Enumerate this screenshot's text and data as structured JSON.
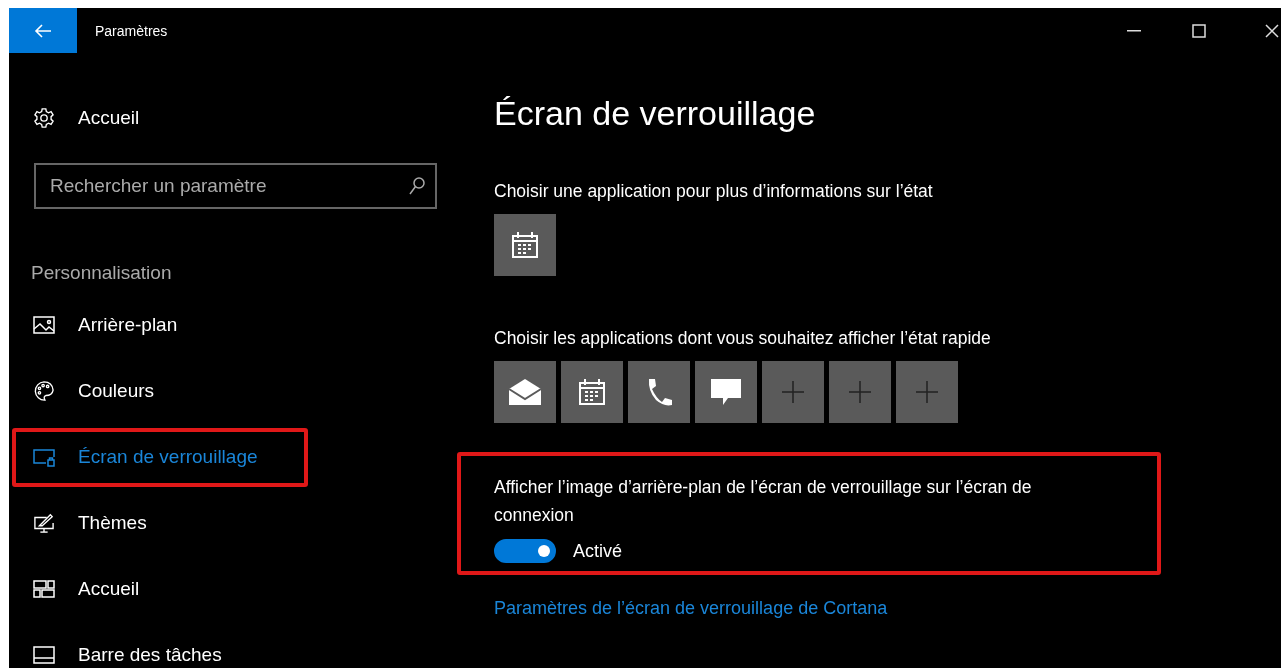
{
  "window": {
    "title": "Paramètres"
  },
  "sidebar": {
    "home": {
      "label": "Accueil"
    },
    "search": {
      "placeholder": "Rechercher un paramètre"
    },
    "section": "Personnalisation",
    "items": [
      {
        "label": "Arrière-plan",
        "kind": "picture",
        "selected": false,
        "highlighted": false
      },
      {
        "label": "Couleurs",
        "kind": "palette",
        "selected": false,
        "highlighted": false
      },
      {
        "label": "Écran de verrouillage",
        "kind": "lock-screen",
        "selected": true,
        "highlighted": true
      },
      {
        "label": "Thèmes",
        "kind": "themes",
        "selected": false,
        "highlighted": false
      },
      {
        "label": "Accueil",
        "kind": "start",
        "selected": false,
        "highlighted": false
      },
      {
        "label": "Barre des tâches",
        "kind": "taskbar",
        "selected": false,
        "highlighted": false
      }
    ]
  },
  "content": {
    "title": "Écran de verrouillage",
    "detailed_status": {
      "label": "Choisir une application pour plus d’informations sur l’état",
      "apps": [
        {
          "kind": "calendar"
        }
      ]
    },
    "quick_status": {
      "label": "Choisir les applications dont vous souhaitez afficher l’état rapide",
      "apps": [
        {
          "kind": "mail"
        },
        {
          "kind": "calendar"
        },
        {
          "kind": "phone"
        },
        {
          "kind": "message"
        },
        {
          "kind": "add"
        },
        {
          "kind": "add"
        },
        {
          "kind": "add"
        }
      ]
    },
    "signin_background": {
      "label": "Afficher l’image d’arrière-plan de l’écran de verrouillage sur l’écran de connexion",
      "on": true,
      "state_label": "Activé",
      "highlighted": true
    },
    "link": "Paramètres de l’écran de verrouillage de Cortana"
  }
}
